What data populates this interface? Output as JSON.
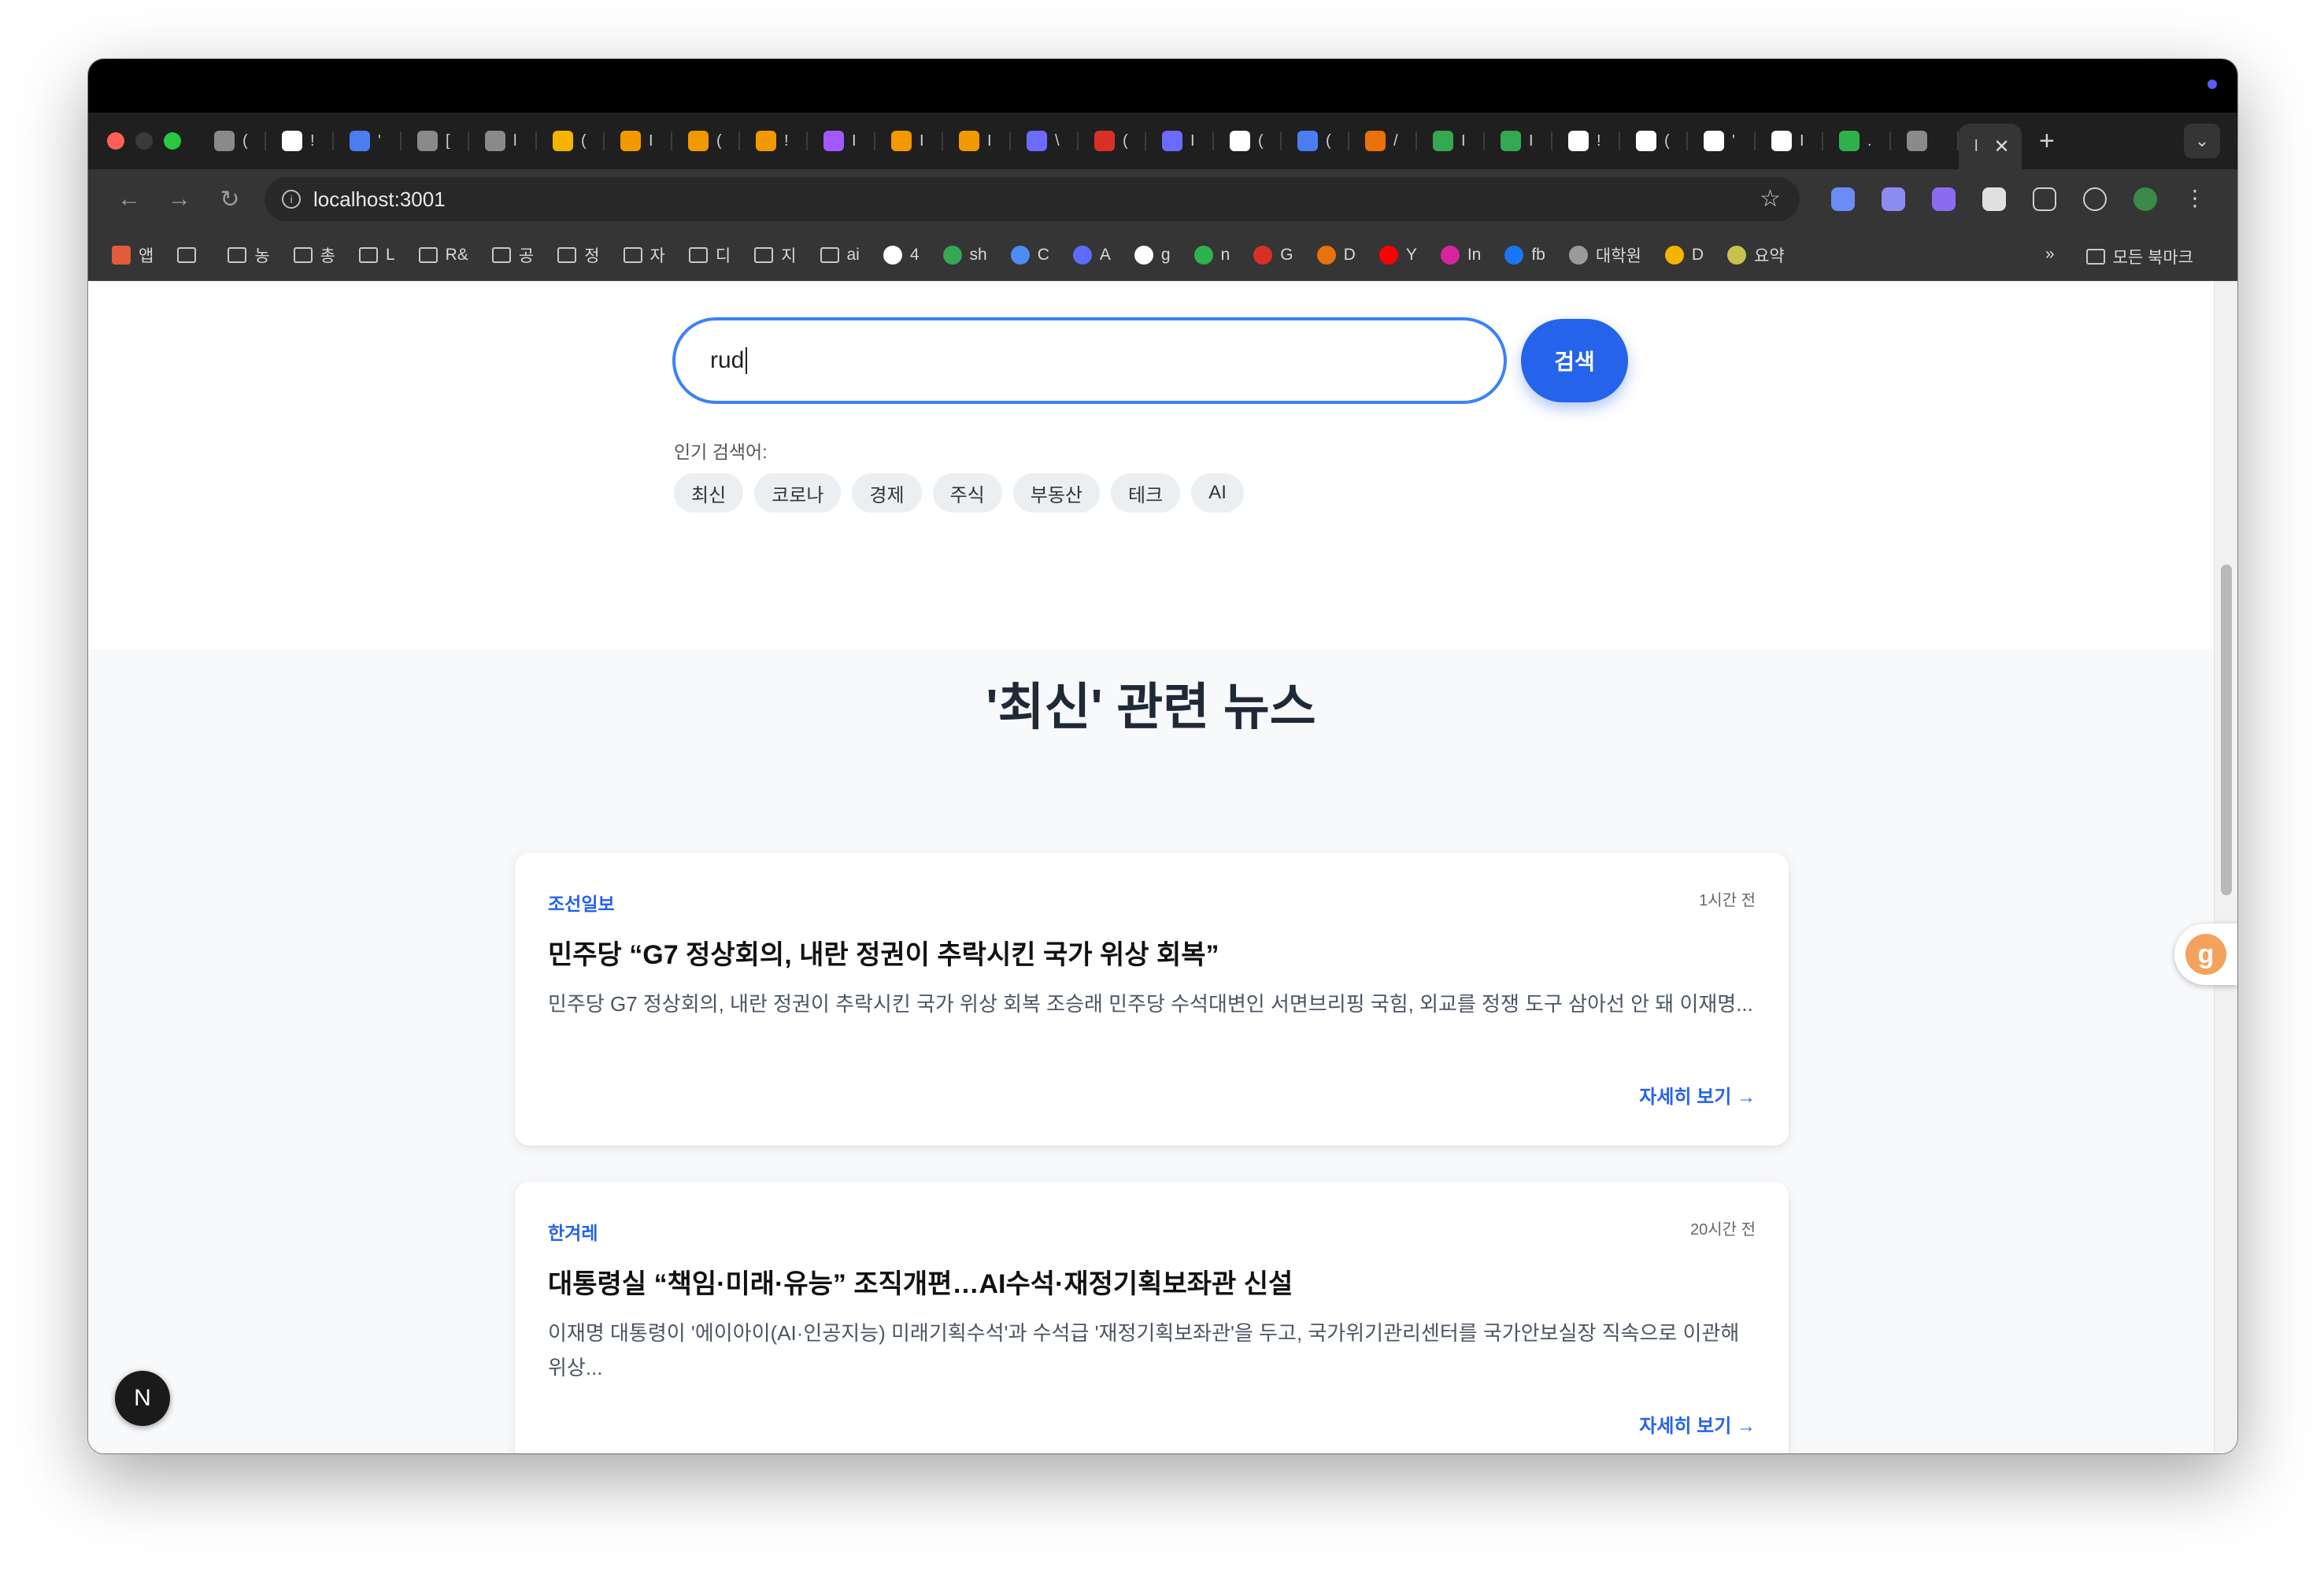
{
  "browser": {
    "url": "localhost:3001",
    "active_tab_label": "l",
    "new_tab": "+",
    "tab_menu": "⌄",
    "tabs": [
      {
        "label": "(",
        "color": "#8a8a8a"
      },
      {
        "label": "!",
        "color": "#ffffff"
      },
      {
        "label": "'",
        "color": "#4c7df0"
      },
      {
        "label": "[",
        "color": "#8a8a8a"
      },
      {
        "label": "l",
        "color": "#8a8a8a"
      },
      {
        "label": "(",
        "color": "#f4b400"
      },
      {
        "label": "I",
        "color": "#f29900"
      },
      {
        "label": "(",
        "color": "#f29900"
      },
      {
        "label": "!",
        "color": "#f29900"
      },
      {
        "label": "I",
        "color": "#a259ff"
      },
      {
        "label": "I",
        "color": "#f29900"
      },
      {
        "label": "I",
        "color": "#f29900"
      },
      {
        "label": "\\",
        "color": "#6b6bff"
      },
      {
        "label": "(",
        "color": "#d93025"
      },
      {
        "label": "I",
        "color": "#6b6bff"
      },
      {
        "label": "(",
        "color": "#ffffff"
      },
      {
        "label": "(",
        "color": "#4c7df0"
      },
      {
        "label": "/",
        "color": "#e8710a"
      },
      {
        "label": "I",
        "color": "#34a853"
      },
      {
        "label": "I",
        "color": "#34a853"
      },
      {
        "label": "!",
        "color": "#ffffff"
      },
      {
        "label": "(",
        "color": "#ffffff"
      },
      {
        "label": "'",
        "color": "#ffffff"
      },
      {
        "label": "I",
        "color": "#ffffff"
      },
      {
        "label": ".",
        "color": "#2fb24c"
      },
      {
        "label": "",
        "color": "#8a8a8a"
      }
    ]
  },
  "bookmarks": {
    "items": [
      {
        "label": "앱",
        "type": "apps"
      },
      {
        "label": "",
        "type": "grid"
      },
      {
        "label": "농",
        "type": "folder"
      },
      {
        "label": "총",
        "type": "folder"
      },
      {
        "label": "L",
        "type": "folder"
      },
      {
        "label": "R&",
        "type": "folder"
      },
      {
        "label": "공",
        "type": "folder"
      },
      {
        "label": "정",
        "type": "folder"
      },
      {
        "label": "자",
        "type": "folder"
      },
      {
        "label": "디",
        "type": "folder"
      },
      {
        "label": "지",
        "type": "folder"
      },
      {
        "label": "ai",
        "type": "folder"
      },
      {
        "label": "4",
        "type": "site",
        "color": "#ffffff"
      },
      {
        "label": "sh",
        "type": "site",
        "color": "#34a853"
      },
      {
        "label": "C",
        "type": "site",
        "color": "#4c8df5"
      },
      {
        "label": "A",
        "type": "site",
        "color": "#5b6cff"
      },
      {
        "label": "g",
        "type": "site",
        "color": "#ffffff"
      },
      {
        "label": "n",
        "type": "site",
        "color": "#2fb24c"
      },
      {
        "label": "G",
        "type": "site",
        "color": "#d93025"
      },
      {
        "label": "D",
        "type": "site",
        "color": "#e8710a"
      },
      {
        "label": "Y",
        "type": "site",
        "color": "#ff0000"
      },
      {
        "label": "In",
        "type": "site",
        "color": "#d6249f"
      },
      {
        "label": "fb",
        "type": "site",
        "color": "#1877f2"
      },
      {
        "label": "대학원",
        "type": "site",
        "color": "#9a9a9a"
      },
      {
        "label": "D",
        "type": "site",
        "color": "#f4b400"
      },
      {
        "label": "요약",
        "type": "site",
        "color": "#c9c14b"
      }
    ],
    "overflow": "»",
    "all_bookmarks": "모든 북마크"
  },
  "search": {
    "value": "rud",
    "button_label": "검색",
    "popular_label": "인기 검색어:",
    "chips": [
      "최신",
      "코로나",
      "경제",
      "주식",
      "부동산",
      "테크",
      "AI"
    ]
  },
  "results": {
    "title": "'최신' 관련 뉴스",
    "articles": [
      {
        "source": "조선일보",
        "time": "1시간 전",
        "headline": "민주당 “G7 정상회의, 내란 정권이 추락시킨 국가 위상 회복”",
        "summary": "민주당 G7 정상회의, 내란 정권이 추락시킨 국가 위상 회복 조승래 민주당 수석대변인 서면브리핑 국힘, 외교를 정쟁 도구 삼아선 안 돼 이재명...",
        "more": "자세히 보기 →"
      },
      {
        "source": "한겨레",
        "time": "20시간 전",
        "headline": "대통령실 “책임·미래·유능” 조직개편…AI수석·재정기획보좌관 신설",
        "summary": "이재명 대통령이 '에이아이(AI·인공지능) 미래기획수석'과 수석급 '재정기획보좌관'을 두고, 국가위기관리센터를 국가안보실장 직속으로 이관해 위상...",
        "more": "자세히 보기 →"
      }
    ]
  },
  "badges": {
    "extension_letter": "g",
    "nextjs_letter": "N"
  }
}
